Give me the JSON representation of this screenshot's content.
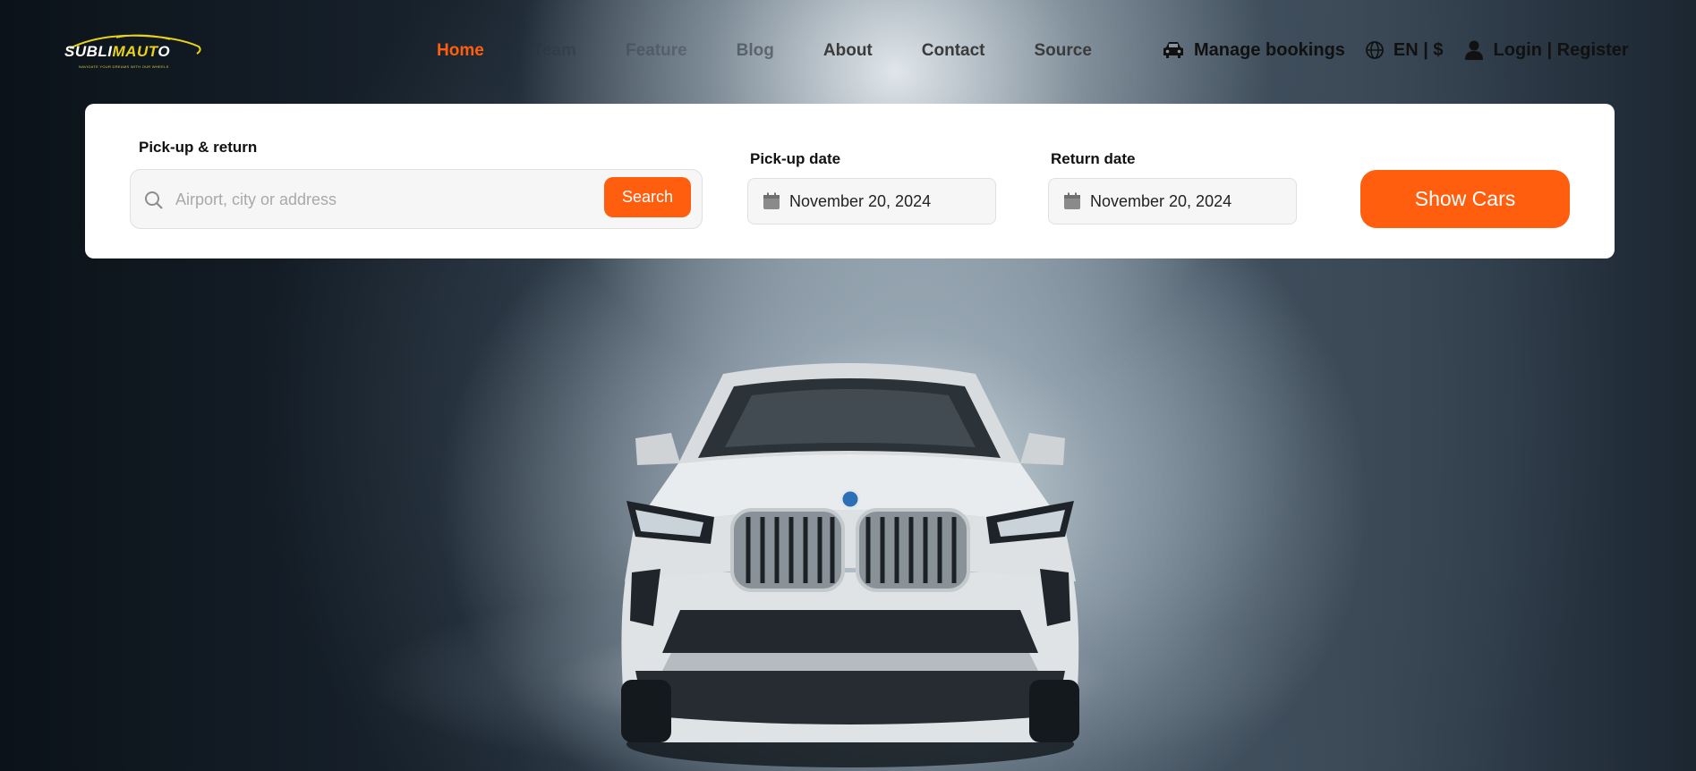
{
  "brand": {
    "logo_prefix": "S",
    "logo_mid": "UBLI",
    "logo_highlight": "MAUT",
    "logo_suffix": "O",
    "tagline": "NAVIGATE YOUR DREAMS WITH OUR WHEELS"
  },
  "nav": {
    "links": [
      {
        "label": "Home",
        "icon": null
      },
      {
        "label": "Team"
      },
      {
        "label": "Feature"
      },
      {
        "label": "Blog"
      },
      {
        "label": "About"
      },
      {
        "label": "Contact"
      },
      {
        "label": "Source"
      }
    ],
    "manage_bookings": {
      "label": "Manage bookings",
      "icon": "car-icon"
    },
    "locale": {
      "label": "EN | $",
      "icon": "globe-icon"
    },
    "account": {
      "label": "Login | Register",
      "icon": "user-icon"
    }
  },
  "search": {
    "location_label": "Pick-up & return",
    "location_placeholder": "Airport, city or address",
    "search_button": "Search",
    "pickup_label": "Pick-up date",
    "pickup_value": "November 20, 2024",
    "return_label": "Return date",
    "return_value": "November 20, 2024",
    "show_cars_button": "Show Cars"
  },
  "colors": {
    "accent": "#ff5e0e",
    "logo_yellow": "#e8d21a",
    "card_bg": "#ffffff"
  }
}
